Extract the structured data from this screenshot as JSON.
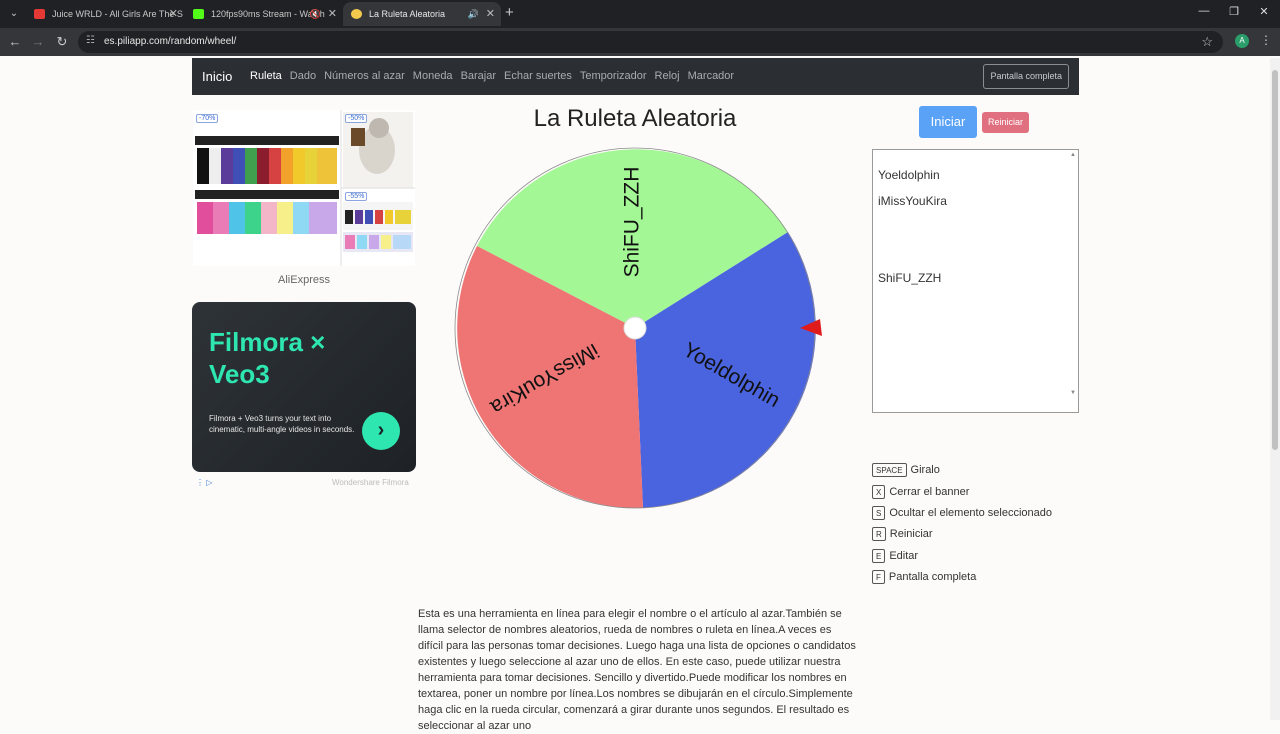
{
  "browser": {
    "tabs": [
      {
        "title": "Juice WRLD - All Girls Are The S",
        "favicon_color": "#e53935"
      },
      {
        "title": "120fps90ms Stream - Watch",
        "favicon_color": "#53fc18"
      },
      {
        "title": "La Ruleta Aleatoria",
        "favicon_color": "#f2c94c"
      }
    ],
    "url": "es.piliapp.com/random/wheel/",
    "profile_initial": "A"
  },
  "nav": {
    "brand": "Inicio",
    "links": [
      "Ruleta",
      "Dado",
      "Números al azar",
      "Moneda",
      "Barajar",
      "Echar suertes",
      "Temporizador",
      "Reloj",
      "Marcador"
    ],
    "fullscreen": "Pantalla completa"
  },
  "ads": {
    "ali": {
      "badge1": "-70%",
      "badge2": "-50%",
      "badge3": "-55%",
      "label": "AliExpress"
    },
    "filmora": {
      "title": "Filmora × Veo3",
      "body": "Filmora + Veo3 turns your text into cinematic, multi-angle videos in seconds.",
      "footer": "Wondershare Filmora"
    }
  },
  "page": {
    "title": "La Ruleta Aleatoria",
    "start": "Iniciar",
    "reset": "Reiniciar"
  },
  "wheel": {
    "segments": [
      {
        "label": "ShiFU_ZZH",
        "color": "#a3f795"
      },
      {
        "label": "Yoeldolphin",
        "color": "#4a63df"
      },
      {
        "label": "iMissYouKira",
        "color": "#ef7474"
      }
    ],
    "pointer_color": "#e01b1b"
  },
  "names": [
    "Yoeldolphin",
    "iMissYouKira",
    "ShiFU_ZZH"
  ],
  "shortcuts": [
    {
      "key": "SPACE",
      "label": "Giralo"
    },
    {
      "key": "X",
      "label": "Cerrar el banner"
    },
    {
      "key": "S",
      "label": "Ocultar el elemento seleccionado"
    },
    {
      "key": "R",
      "label": "Reiniciar"
    },
    {
      "key": "E",
      "label": "Editar"
    },
    {
      "key": "F",
      "label": "Pantalla completa"
    }
  ],
  "description": "Esta es una herramienta en línea para elegir el nombre o el artículo al azar.También se llama selector de nombres aleatorios, rueda de nombres o ruleta en línea.A veces es difícil para las personas tomar decisiones. Luego haga una lista de opciones o candidatos existentes y luego seleccione al azar uno de ellos. En este caso, puede utilizar nuestra herramienta para tomar decisiones. Sencillo y divertido.Puede modificar los nombres en textarea, poner un nombre por línea.Los nombres se dibujarán en el círculo.Simplemente haga clic en la rueda circular, comenzará a girar durante unos segundos. El resultado es seleccionar al azar uno"
}
